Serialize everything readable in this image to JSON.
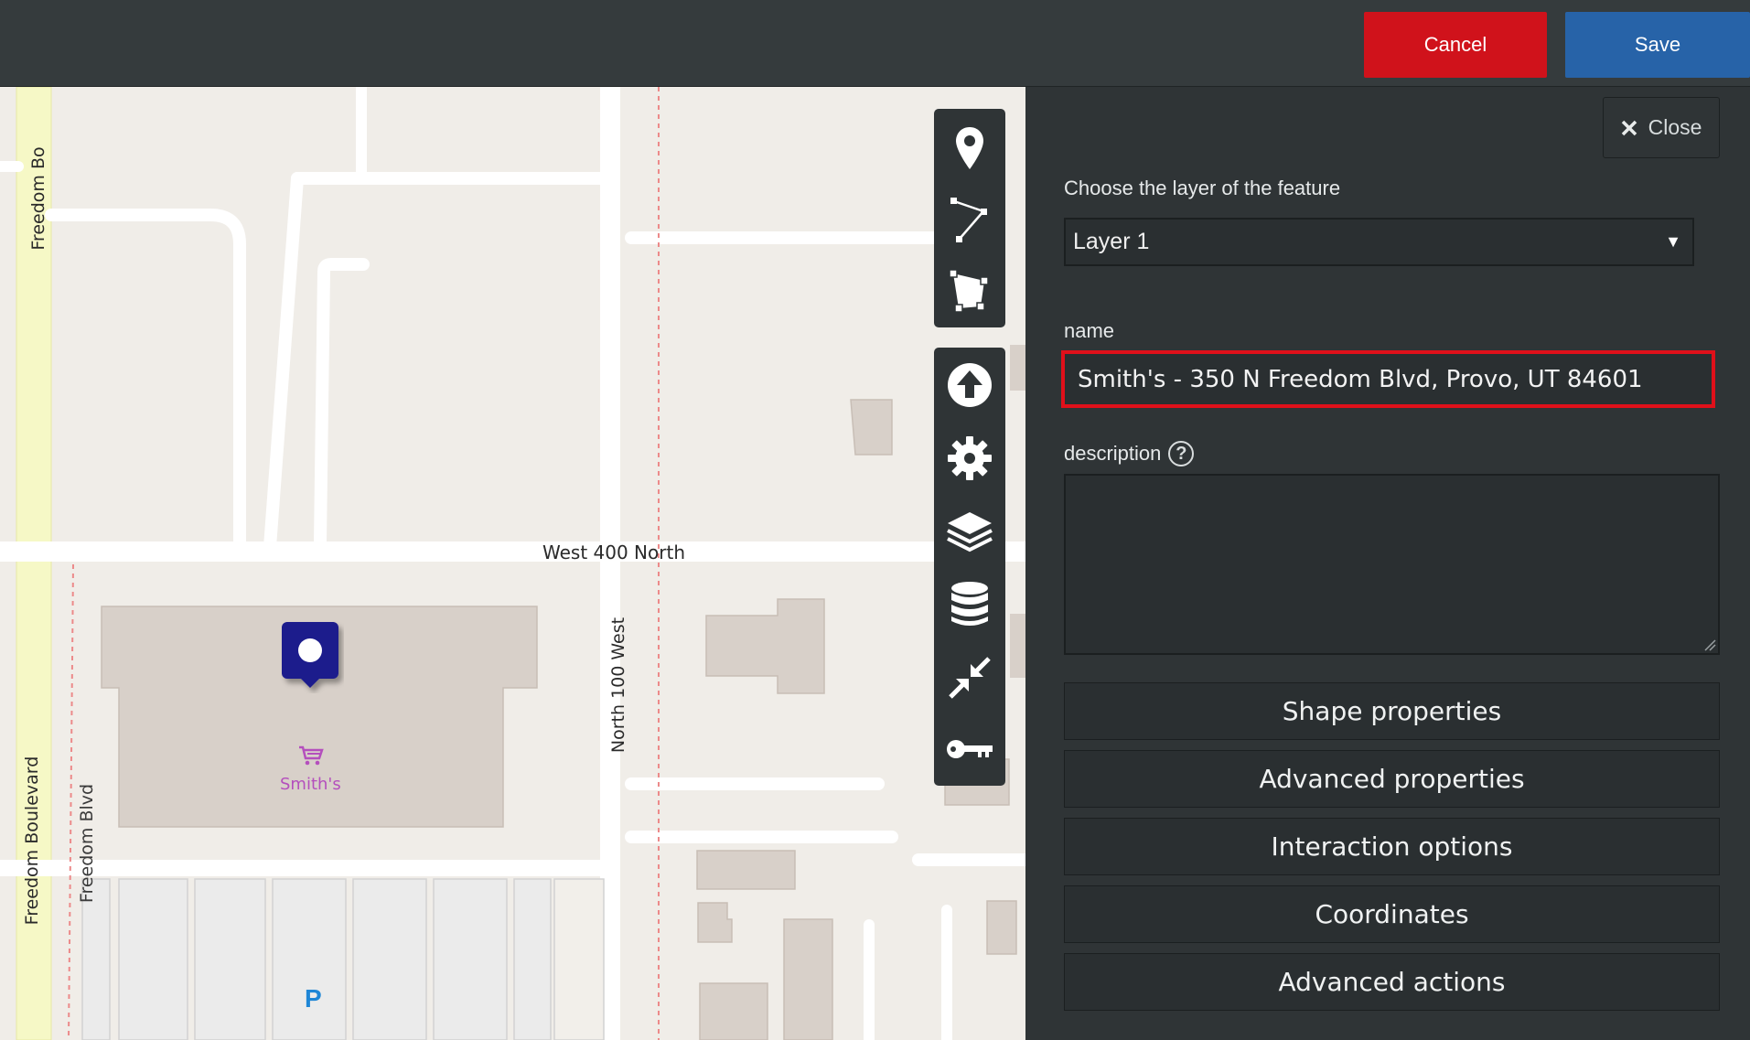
{
  "header": {
    "cancel_label": "Cancel",
    "save_label": "Save"
  },
  "map": {
    "streets": {
      "freedom_bo_top": "Freedom Bo",
      "freedom_boulevard": "Freedom Boulevard",
      "freedom_blvd": "Freedom Blvd",
      "west_400_north": "West 400 North",
      "north_100_west": "North 100 West"
    },
    "poi": {
      "store_name": "Smith's",
      "parking": "P"
    },
    "toolbar_icons": [
      "marker-icon",
      "polyline-icon",
      "polygon-icon",
      "upload-icon",
      "gear-icon",
      "layers-icon",
      "database-icon",
      "shrink-icon",
      "key-icon"
    ],
    "colors": {
      "marker": "#1a1a8c",
      "poi": "#b44fbd",
      "parking": "#1e86d6"
    }
  },
  "panel": {
    "close_label": "Close",
    "layer_label": "Choose the layer of the feature",
    "layer_value": "Layer 1",
    "name_label": "name",
    "name_value": "Smith's - 350 N Freedom Blvd, Provo, UT 84601",
    "description_label": "description",
    "help_glyph": "?",
    "sections": [
      "Shape properties",
      "Advanced properties",
      "Interaction options",
      "Coordinates",
      "Advanced actions"
    ]
  },
  "colors": {
    "cancel": "#d0121b",
    "save": "#2763a8",
    "panel": "#2f3436",
    "highlight": "#e0101a"
  }
}
